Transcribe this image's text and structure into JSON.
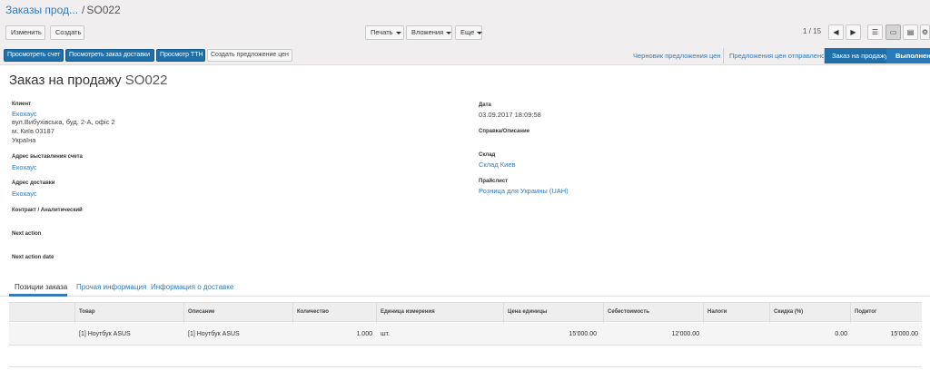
{
  "breadcrumb": {
    "parent": "Заказы прод...",
    "separator": "/",
    "current": "SO022"
  },
  "toolbar": {
    "edit_label": "Изменить",
    "create_label": "Создать",
    "print_label": "Печать",
    "attachments_label": "Вложения",
    "more_label": "Еще",
    "pager": "1 / 15"
  },
  "action_buttons": {
    "view_invoice": "Просмотреть счет",
    "view_delivery": "Посмотреть заказ доставки",
    "view_ttn": "Просмотр ТТН",
    "create_proposal": "Создать предложение цен"
  },
  "statusbar": {
    "draft": "Черновик предложения цен",
    "sent": "Предложения цен отправлено",
    "sale": "Заказ на продажу",
    "done": "Выполнено"
  },
  "form": {
    "title_prefix": "Заказ на продажу",
    "title_number": "SO022",
    "client_label": "Клиент",
    "client_name": "Екохаус",
    "client_addr1": "вул.Вибухівська, буд. 2-А, офіс 2",
    "client_addr2": "м. Київ 03187",
    "client_addr3": "Україна",
    "invoice_addr_label": "Адрес выставления счета",
    "invoice_addr_value": "Екохаус",
    "delivery_addr_label": "Адрес доставки",
    "delivery_addr_value": "Екохаус",
    "contract_label": "Контракт / Аналитический",
    "next_action_label": "Next action",
    "next_action_date_label": "Next action date",
    "date_label": "Дата",
    "date_value": "03.09.2017 18:09:58",
    "reference_label": "Справка/Описание",
    "warehouse_label": "Склад",
    "warehouse_value": "Склад Киев",
    "pricelist_label": "Прайслист",
    "pricelist_value": "Розница для Украины (UAH)"
  },
  "tabs": {
    "lines": "Позиции заказа",
    "other": "Прочая информация",
    "delivery": "Информация о доставке"
  },
  "table": {
    "headers": [
      "Товар",
      "Описание",
      "Количество",
      "Единица измерения",
      "Цена единицы",
      "Себестоимость",
      "Налоги",
      "Скидка (%)",
      "Подитог"
    ],
    "rows": [
      [
        "[1] Ноутбук ASUS",
        "[1] Ноутбук ASUS",
        "1.000",
        "шт.",
        "15'000.00",
        "12'000.00",
        "",
        "0.00",
        "15'000.00"
      ]
    ]
  },
  "colors": {
    "link": "#337ab7",
    "primary": "#1f6fa8",
    "control_panel": "#f0eeee"
  }
}
